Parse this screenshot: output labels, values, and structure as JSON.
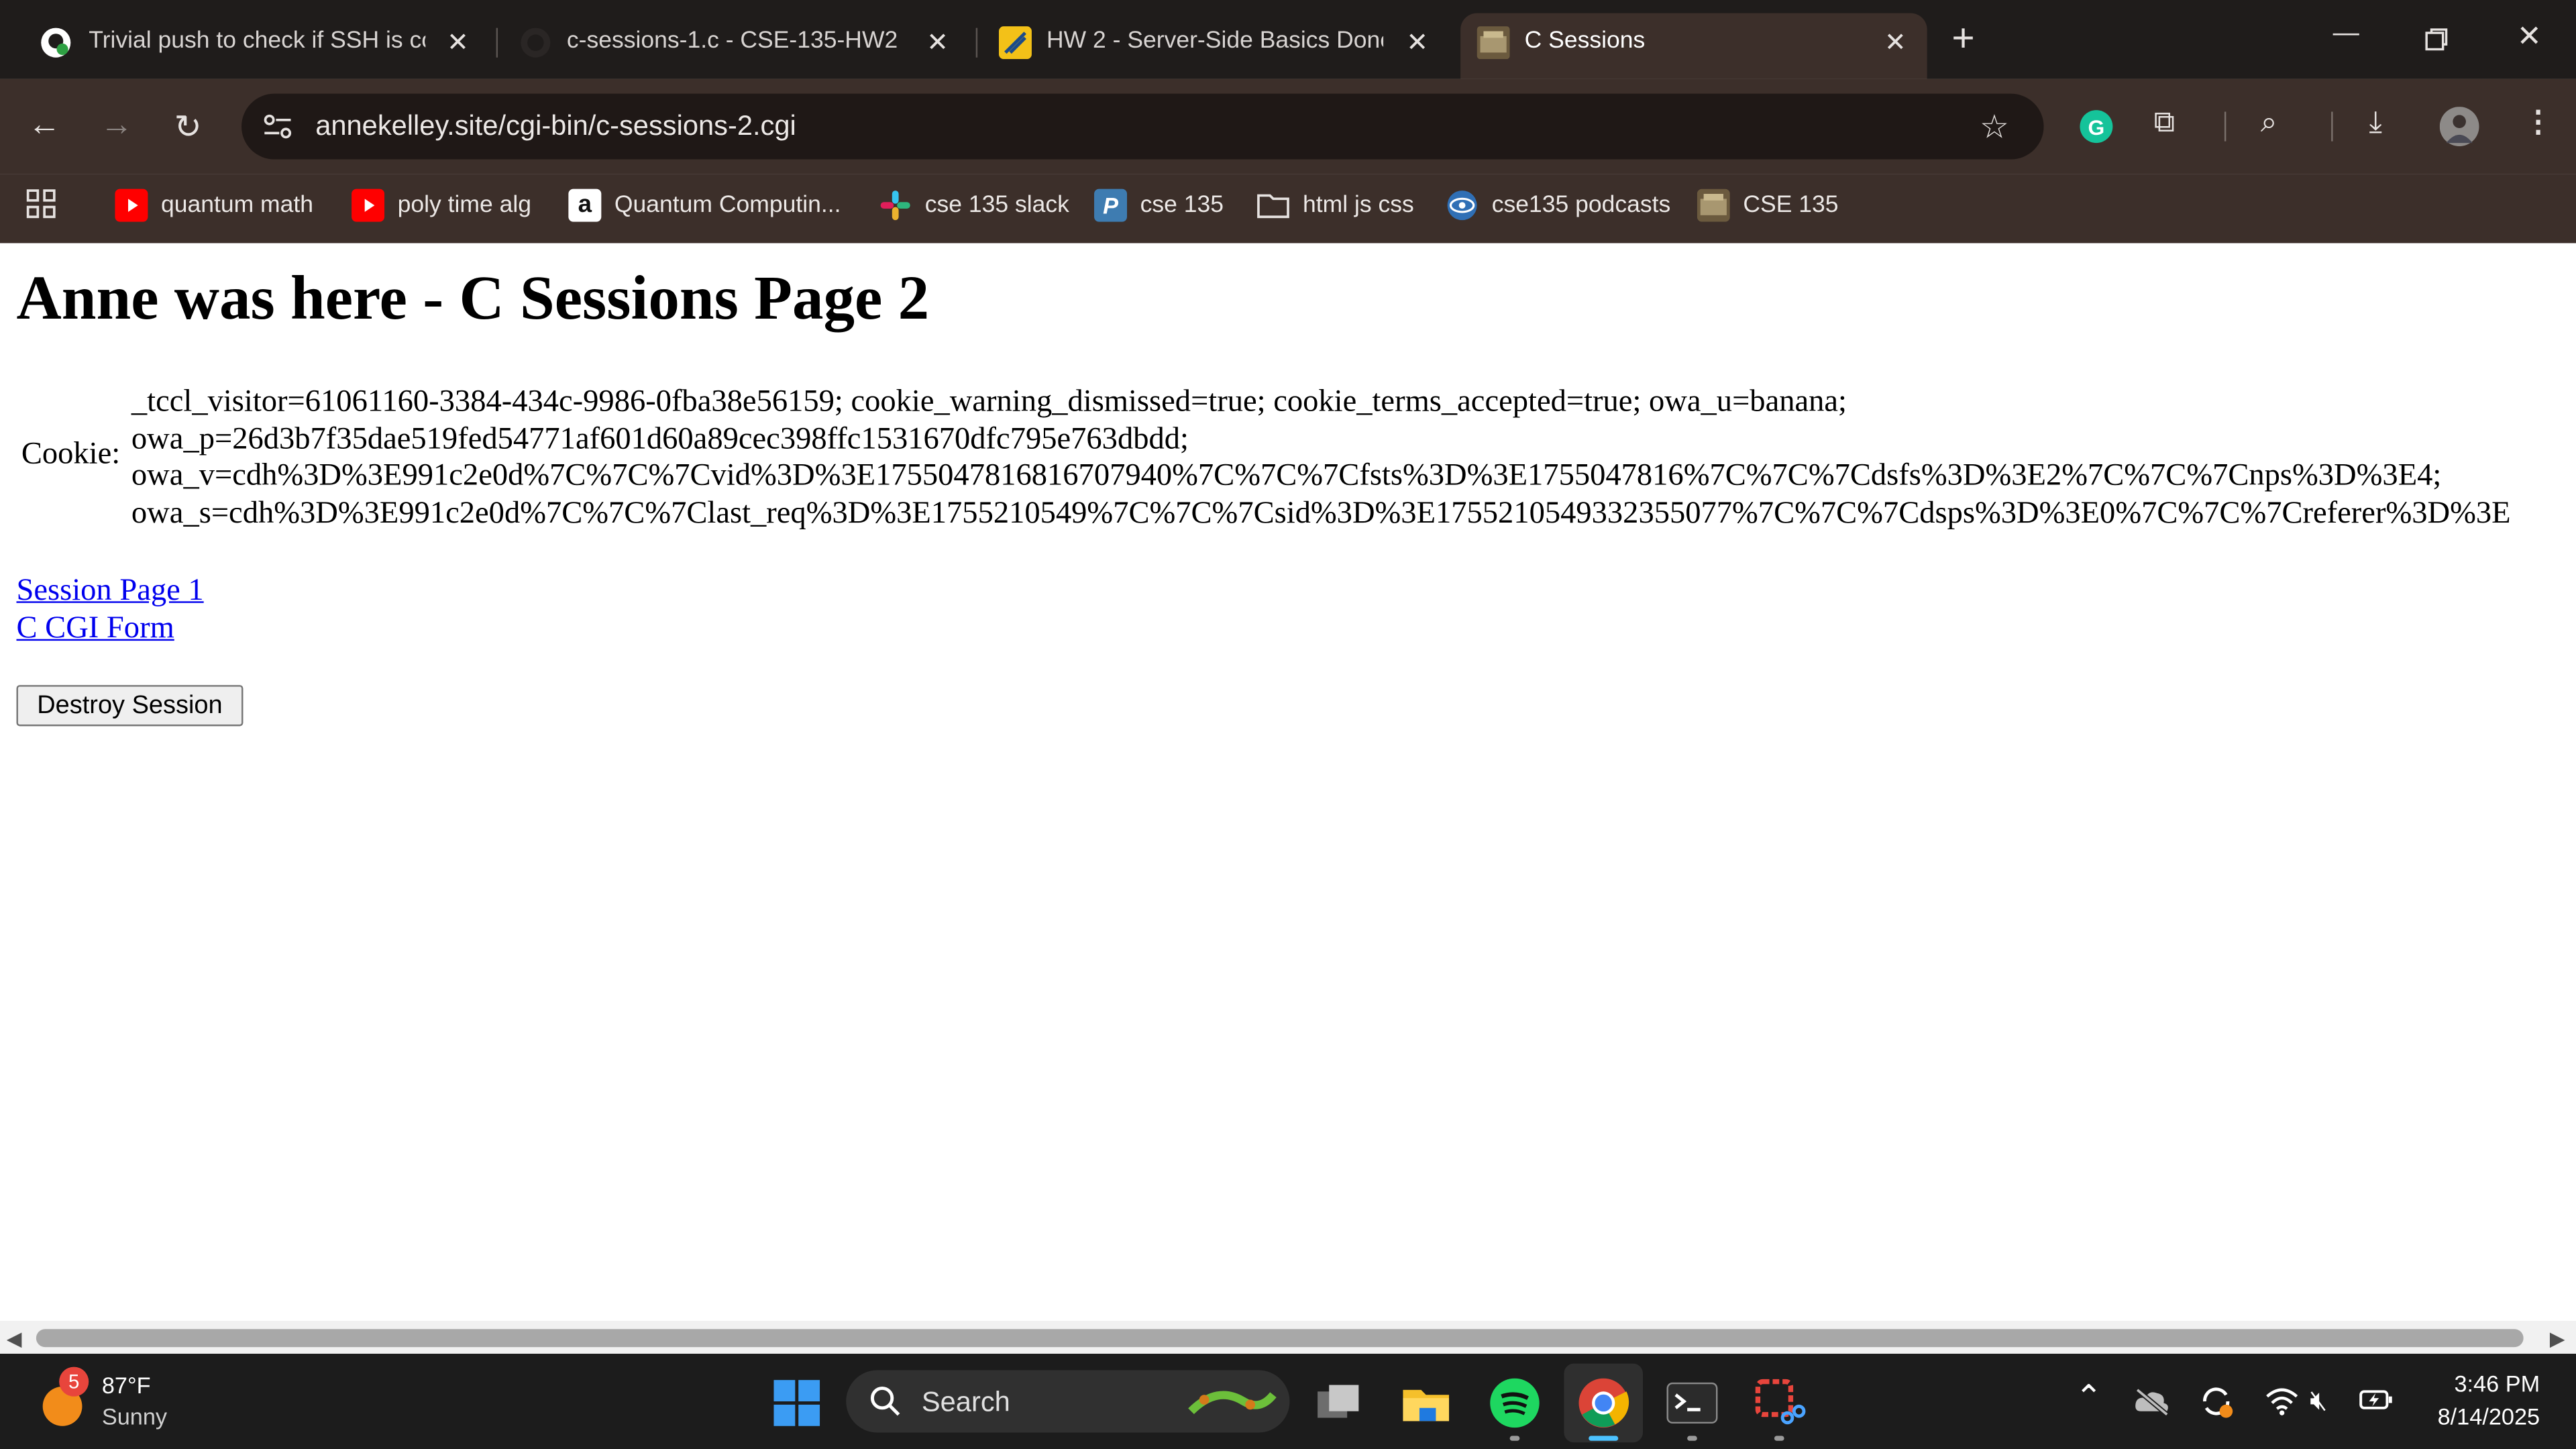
{
  "browser": {
    "tabs": [
      {
        "title": "Trivial push to check if SSH is co",
        "favicon": "github-icon",
        "active": false
      },
      {
        "title": "c-sessions-1.c - CSE-135-HW2 (",
        "favicon": "github-icon",
        "active": false
      },
      {
        "title": "HW 2 - Server-Side Basics Done",
        "favicon": "canvas-icon",
        "active": false
      },
      {
        "title": "C Sessions",
        "favicon": "cse135-icon",
        "active": true
      }
    ],
    "new_tab_label": "+",
    "url": "annekelley.site/cgi-bin/c-sessions-2.cgi",
    "bookmarks": [
      {
        "label": "quantum math",
        "icon": "youtube-icon"
      },
      {
        "label": "poly time alg",
        "icon": "youtube-icon"
      },
      {
        "label": "Quantum Computin...",
        "icon": "amazon-icon"
      },
      {
        "label": "cse 135 slack",
        "icon": "slack-icon"
      },
      {
        "label": "cse 135",
        "icon": "piazza-icon"
      },
      {
        "label": "html js css",
        "icon": "folder-icon"
      },
      {
        "label": "cse135 podcasts",
        "icon": "podcast-icon"
      },
      {
        "label": "CSE 135",
        "icon": "cse135-icon"
      }
    ]
  },
  "page": {
    "heading": "Anne was here - C Sessions Page 2",
    "cookie_label": "Cookie:",
    "cookie_lines": [
      "_tccl_visitor=61061160-3384-434c-9986-0fba38e56159; cookie_warning_dismissed=true; cookie_terms_accepted=true; owa_u=banana;",
      "owa_p=26d3b7f35dae519fed54771af601d60a89cec398ffc1531670dfc795e763dbdd;",
      "owa_v=cdh%3D%3E991c2e0d%7C%7C%7Cvid%3D%3E1755047816816707940%7C%7C%7Cfsts%3D%3E1755047816%7C%7C%7Cdsfs%3D%3E2%7C%7C%7Cnps%3D%3E4;",
      "owa_s=cdh%3D%3E991c2e0d%7C%7C%7Clast_req%3D%3E1755210549%7C%7C%7Csid%3D%3E1755210549332355077%7C%7C%7Cdsps%3D%3E0%7C%7C%7Creferer%3D%3E"
    ],
    "links": [
      "Session Page 1",
      "C CGI Form"
    ],
    "destroy_button": "Destroy Session"
  },
  "taskbar": {
    "weather_badge": "5",
    "weather_temp": "87°F",
    "weather_cond": "Sunny",
    "search_label": "Search",
    "time": "3:46 PM",
    "date": "8/14/2025"
  }
}
